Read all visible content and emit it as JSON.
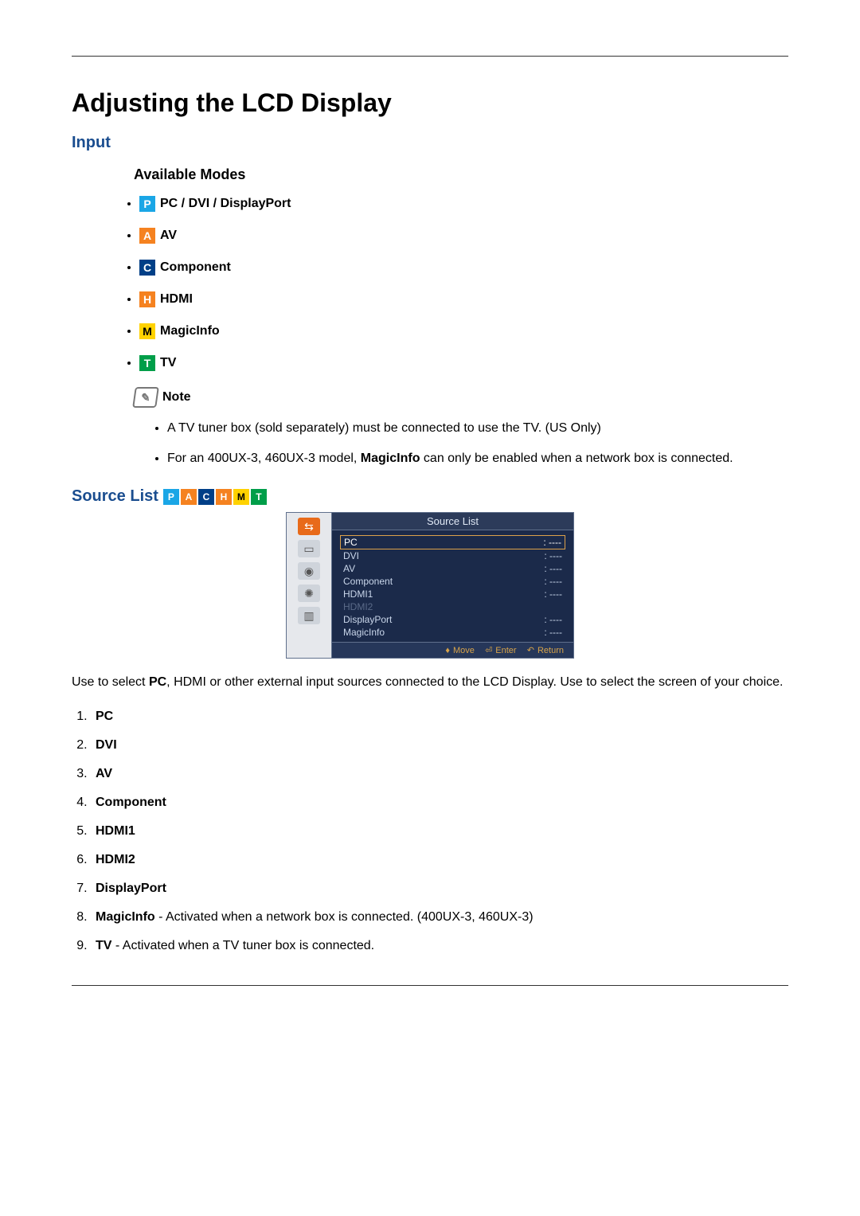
{
  "title": "Adjusting the LCD Display",
  "section_input": "Input",
  "available_modes_heading": "Available Modes",
  "modes": [
    {
      "letter": "P",
      "cls": "p",
      "label": "PC / DVI / DisplayPort"
    },
    {
      "letter": "A",
      "cls": "a",
      "label": "AV"
    },
    {
      "letter": "C",
      "cls": "c",
      "label": "Component"
    },
    {
      "letter": "H",
      "cls": "h",
      "label": "HDMI"
    },
    {
      "letter": "M",
      "cls": "m",
      "label": "MagicInfo"
    },
    {
      "letter": "T",
      "cls": "t",
      "label": "TV"
    }
  ],
  "note_label": "Note",
  "notes": [
    {
      "html": "A TV tuner box (sold separately) must be connected to use the TV. (US Only)"
    },
    {
      "html": "For an 400UX-3, 460UX-3 model, <b>MagicInfo</b> can only be enabled when a network box is connected."
    }
  ],
  "source_list_heading": "Source List",
  "strip": [
    "P",
    "A",
    "C",
    "H",
    "M",
    "T"
  ],
  "strip_cls": [
    "p",
    "a",
    "c",
    "h",
    "m",
    "t"
  ],
  "osd": {
    "title": "Source List",
    "rows": [
      {
        "name": "PC",
        "val": ": ----",
        "sel": true
      },
      {
        "name": "DVI",
        "val": ": ----"
      },
      {
        "name": "AV",
        "val": ": ----"
      },
      {
        "name": "Component",
        "val": ": ----"
      },
      {
        "name": "HDMI1",
        "val": ": ----"
      },
      {
        "name": "HDMI2",
        "val": "",
        "dim": true
      },
      {
        "name": "DisplayPort",
        "val": ": ----"
      },
      {
        "name": "MagicInfo",
        "val": ": ----"
      }
    ],
    "footer": {
      "move": "Move",
      "enter": "Enter",
      "ret": "Return"
    }
  },
  "description_html": "Use to select <b>PC</b>, HDMI or other external input sources connected to the LCD Display. Use to select the screen of your choice.",
  "source_items": [
    {
      "bold": "PC",
      "rest": ""
    },
    {
      "bold": "DVI",
      "rest": ""
    },
    {
      "bold": "AV",
      "rest": ""
    },
    {
      "bold": "Component",
      "rest": ""
    },
    {
      "bold": "HDMI1",
      "rest": ""
    },
    {
      "bold": "HDMI2",
      "rest": ""
    },
    {
      "bold": "DisplayPort",
      "rest": ""
    },
    {
      "bold": "MagicInfo",
      "rest": " - Activated when a network box is connected. (400UX-3, 460UX-3)"
    },
    {
      "bold": "TV",
      "rest": " - Activated when a TV tuner box is connected."
    }
  ]
}
